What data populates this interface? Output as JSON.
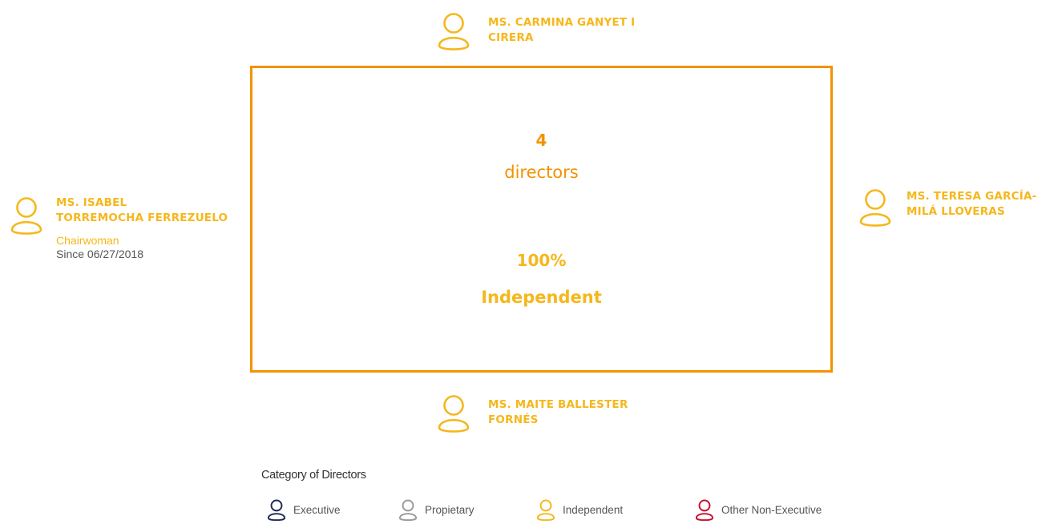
{
  "colors": {
    "independent": "#F5B71B",
    "accent": "#F39200",
    "executive": "#1F2A57",
    "proprietary": "#9A9A9A",
    "other_non_executive": "#C8102E",
    "text_gray": "#555555"
  },
  "directors": {
    "top": {
      "line1": "MS. CARMINA GANYET I",
      "line2": "CIRERA",
      "icon": "person-icon"
    },
    "left": {
      "line1": "MS. ISABEL",
      "line2": "TORREMOCHA FERREZUELO",
      "role": "Chairwoman",
      "since": "Since 06/27/2018",
      "icon": "person-icon"
    },
    "right": {
      "line1": "MS. TERESA GARCÍA-",
      "line2": "MILÁ LLOVERAS",
      "icon": "person-icon"
    },
    "bottom": {
      "line1": "MS. MAITE BALLESTER",
      "line2": "FORNÉS",
      "icon": "person-icon"
    }
  },
  "summary": {
    "count": "4",
    "count_label": "directors",
    "percentage": "100%",
    "category": "Independent"
  },
  "legend": {
    "title": "Category of Directors",
    "items": [
      {
        "label": "Executive",
        "color": "#1F2A57",
        "icon": "person-icon"
      },
      {
        "label": "Propietary",
        "color": "#9A9A9A",
        "icon": "person-icon"
      },
      {
        "label": "Independent",
        "color": "#F5B71B",
        "icon": "person-icon"
      },
      {
        "label": "Other Non-Executive",
        "color": "#C8102E",
        "icon": "person-icon"
      }
    ]
  }
}
